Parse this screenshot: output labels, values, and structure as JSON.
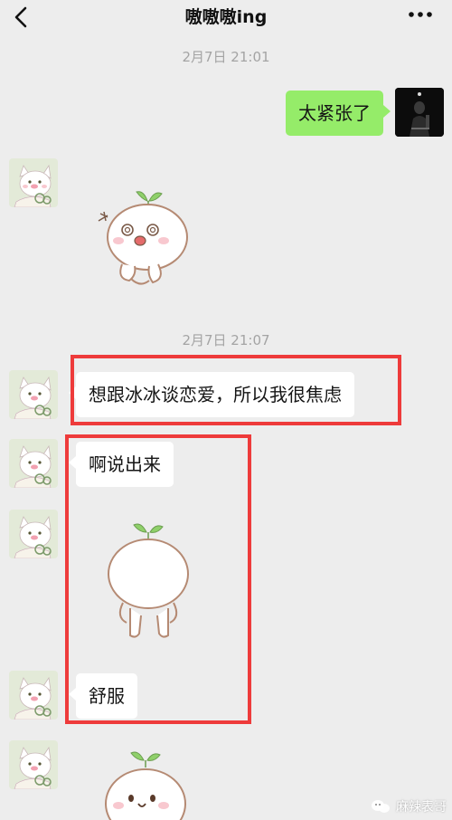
{
  "header": {
    "title": "嗷嗷嗷ing"
  },
  "messages": {
    "time_1": "2月7日 21:01",
    "self_text": "太紧张了",
    "time_2": "2月7日 21:07",
    "text_1": "想跟冰冰谈恋爱，所以我很焦虑",
    "text_2": "啊说出来",
    "text_3": "舒服"
  },
  "watermark": {
    "label": "麻辣表哥"
  },
  "icons": {
    "back": "chevron-left-icon",
    "more": "more-dots-icon",
    "avatar_other": "cartoon-cat-avatar",
    "avatar_self": "photo-avatar",
    "watermark": "wechat-icon"
  },
  "colors": {
    "background": "#ededed",
    "self_bubble": "#95ec69",
    "other_bubble": "#ffffff",
    "highlight_box": "#ee3b3b",
    "timestamp": "#a4a4a4"
  }
}
